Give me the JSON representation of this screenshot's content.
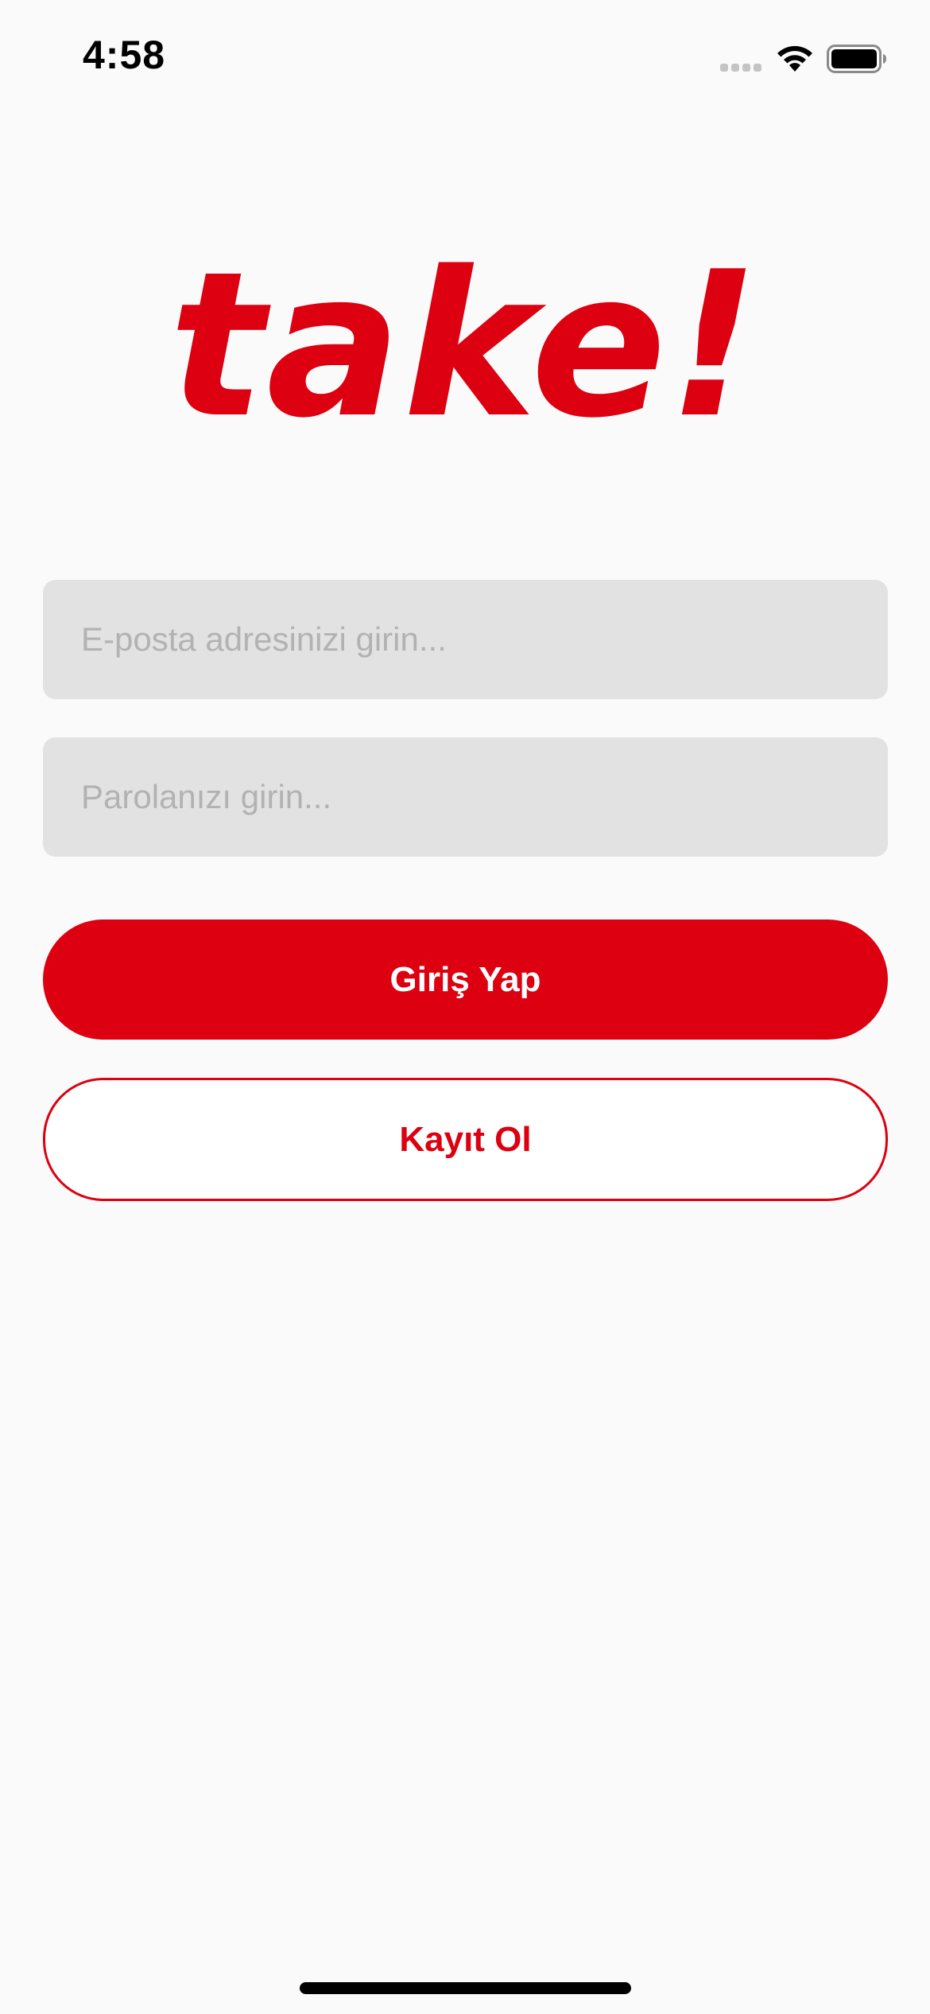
{
  "status_bar": {
    "time": "4:58",
    "icons": [
      "cellular-signal-icon",
      "wifi-icon",
      "battery-icon"
    ]
  },
  "logo": {
    "text": "take!",
    "color": "#dc0010"
  },
  "form": {
    "email": {
      "value": "",
      "placeholder": "E-posta adresinizi girin..."
    },
    "password": {
      "value": "",
      "placeholder": "Parolanızı girin..."
    },
    "login_label": "Giriş Yap",
    "register_label": "Kayıt Ol"
  },
  "colors": {
    "accent": "#dc0010",
    "field_background": "#e2e2e2",
    "placeholder": "#b2b2b2",
    "page_background": "#fafafa"
  }
}
